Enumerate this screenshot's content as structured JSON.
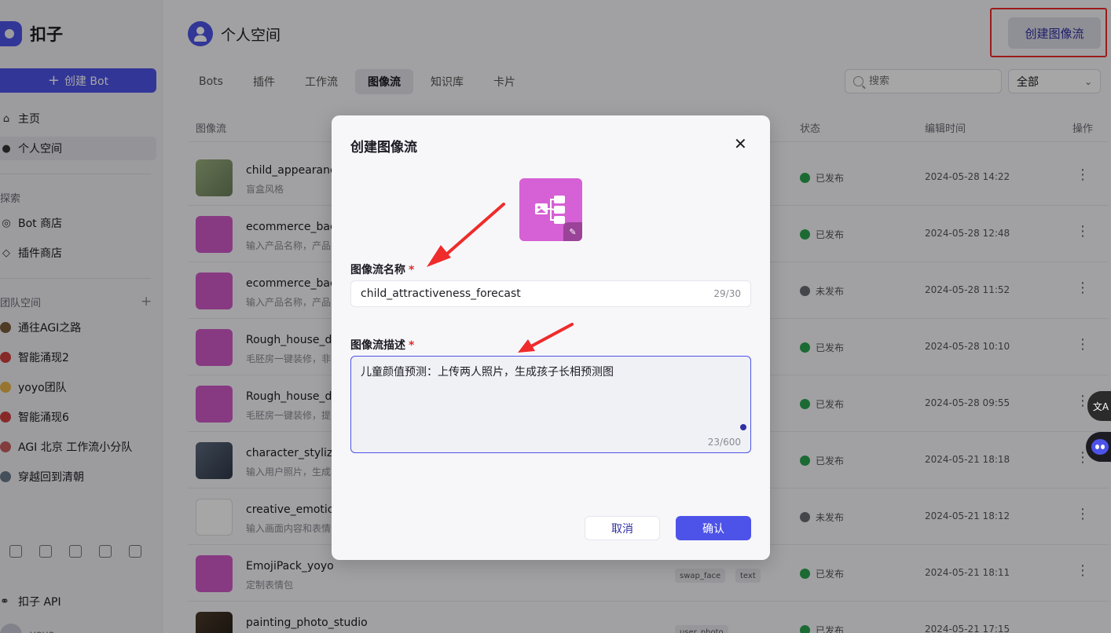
{
  "app": {
    "name": "扣子"
  },
  "sidebar": {
    "create_bot": "创建 Bot",
    "nav": [
      {
        "label": "主页",
        "icon": "home-icon"
      },
      {
        "label": "个人空间",
        "icon": "user-icon"
      }
    ],
    "explore_label": "探索",
    "explore": [
      {
        "label": "Bot 商店",
        "icon": "bot-store-icon"
      },
      {
        "label": "插件商店",
        "icon": "cube-icon"
      }
    ],
    "team_label": "团队空间",
    "teams": [
      {
        "label": "通往AGI之路",
        "color": "#7a5c3c"
      },
      {
        "label": "智能涌现2",
        "color": "#d04040"
      },
      {
        "label": "yoyo团队",
        "color": "#e8b44a"
      },
      {
        "label": "智能涌现6",
        "color": "#d04040"
      },
      {
        "label": "AGI 北京 工作流小分队",
        "color": "#c86060"
      },
      {
        "label": "穿越回到清朝",
        "color": "#6a7a8a"
      }
    ],
    "api_label": "扣子 API",
    "user_label": "yoyo"
  },
  "header": {
    "title": "个人空间",
    "create_button": "创建图像流"
  },
  "tabs": [
    "Bots",
    "插件",
    "工作流",
    "图像流",
    "知识库",
    "卡片"
  ],
  "active_tab": 3,
  "search": {
    "placeholder": "搜索"
  },
  "filter": {
    "value": "全部"
  },
  "table": {
    "headers": {
      "name": "图像流",
      "status": "状态",
      "edited": "编辑时间",
      "actions": "操作"
    },
    "rows": [
      {
        "name": "child_appearanc",
        "desc": "盲盒风格",
        "status": "已发布",
        "published": true,
        "time": "2024-05-28 14:22"
      },
      {
        "name": "ecommerce_bac",
        "desc": "输入产品名称，产品",
        "status": "已发布",
        "published": true,
        "time": "2024-05-28 12:48"
      },
      {
        "name": "ecommerce_bac",
        "desc": "输入产品名称，产品",
        "status": "未发布",
        "published": false,
        "time": "2024-05-28 11:52"
      },
      {
        "name": "Rough_house_de",
        "desc": "毛胚房一键装修，非",
        "status": "已发布",
        "published": true,
        "time": "2024-05-28 10:10"
      },
      {
        "name": "Rough_house_de",
        "desc": "毛胚房一键装修，提",
        "status": "已发布",
        "published": true,
        "time": "2024-05-28 09:55"
      },
      {
        "name": "character_styliza",
        "desc": "输入用户照片，生成",
        "status": "已发布",
        "published": true,
        "time": "2024-05-21 18:18"
      },
      {
        "name": "creative_emotico",
        "desc": "输入画面内容和表情",
        "status": "未发布",
        "published": false,
        "time": "2024-05-21 18:12"
      },
      {
        "name": "EmojiPack_yoyo",
        "desc": "定制表情包",
        "status": "已发布",
        "published": true,
        "time": "2024-05-21 18:11",
        "tags": [
          "swap_face",
          "text"
        ]
      },
      {
        "name": "painting_photo_studio",
        "desc": "",
        "status": "已发布",
        "published": true,
        "time": "2024-05-21 17:15",
        "tags": [
          "user_photo"
        ]
      }
    ]
  },
  "modal": {
    "title": "创建图像流",
    "name_label": "图像流名称",
    "name_value": "child_attractiveness_forecast",
    "name_count": "29/30",
    "desc_label": "图像流描述",
    "desc_value": "儿童颜值预测：上传两人照片，生成孩子长相预测图",
    "desc_count": "23/600",
    "cancel": "取消",
    "confirm": "确认"
  },
  "colors": {
    "accent": "#4d53e8",
    "published": "#2aa44f",
    "icon_bg": "#d660d5",
    "annotation": "#ef2b2b"
  }
}
